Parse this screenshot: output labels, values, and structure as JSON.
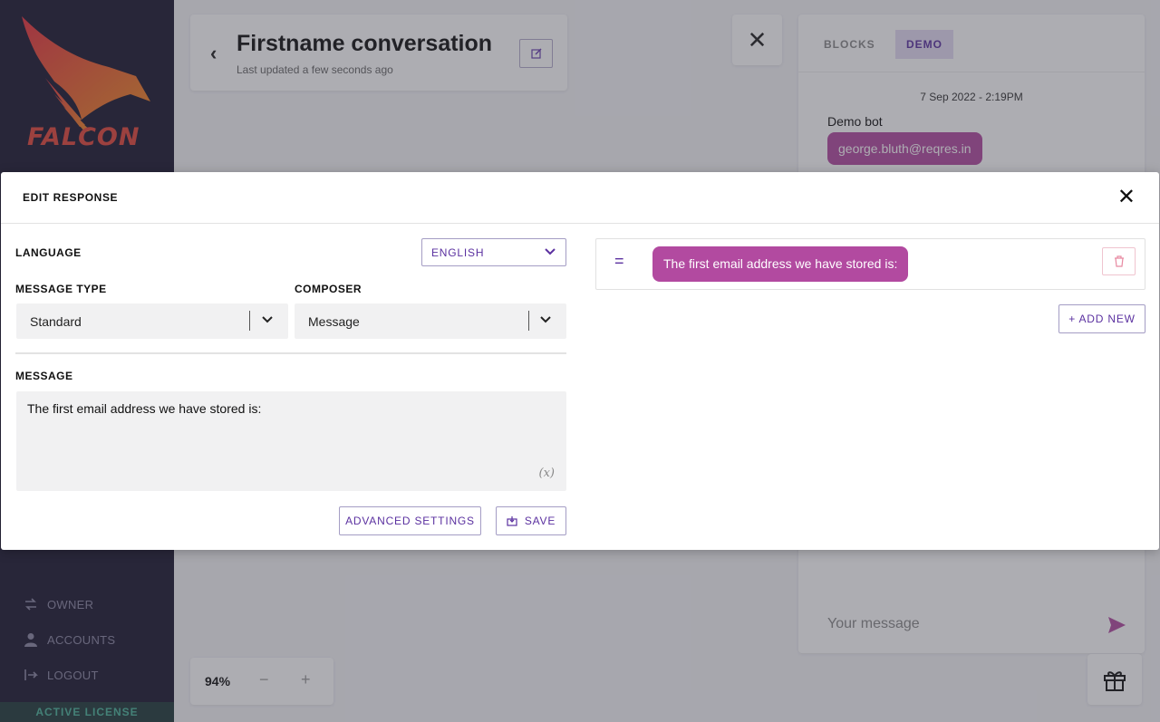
{
  "sidebar": {
    "logo_text": "FALCON",
    "items": [
      {
        "label": "OWNER",
        "icon": "swap-icon"
      },
      {
        "label": "ACCOUNTS",
        "icon": "person-icon"
      },
      {
        "label": "LOGOUT",
        "icon": "logout-icon"
      }
    ],
    "license_label": "ACTIVE LICENSE"
  },
  "header": {
    "title": "Firstname conversation",
    "subtitle": "Last updated a few seconds ago"
  },
  "demo_panel": {
    "tabs": [
      {
        "label": "BLOCKS",
        "active": false
      },
      {
        "label": "DEMO",
        "active": true
      }
    ],
    "timestamp": "7 Sep 2022 - 2:19PM",
    "bot_name": "Demo bot",
    "bot_message": "george.bluth@reqres.in",
    "input_placeholder": "Your message"
  },
  "zoom": {
    "value": "94%",
    "minus": "−",
    "plus": "+"
  },
  "modal": {
    "title": "EDIT RESPONSE",
    "language_label": "LANGUAGE",
    "language_value": "ENGLISH",
    "message_type_label": "MESSAGE TYPE",
    "message_type_value": "Standard",
    "composer_label": "COMPOSER",
    "composer_value": "Message",
    "message_label": "MESSAGE",
    "message_value": "The first email address we have stored is:",
    "variable_hint": "(x)",
    "advanced_settings_label": "ADVANCED SETTINGS",
    "save_label": "SAVE",
    "preview_message": "The first email address we have stored is:",
    "add_new_label": "+ ADD NEW"
  },
  "colors": {
    "accent": "#5b31a0",
    "bubble": "#b24aa0",
    "sidebar_bg": "#1b1830",
    "logo": "#e2453a"
  }
}
